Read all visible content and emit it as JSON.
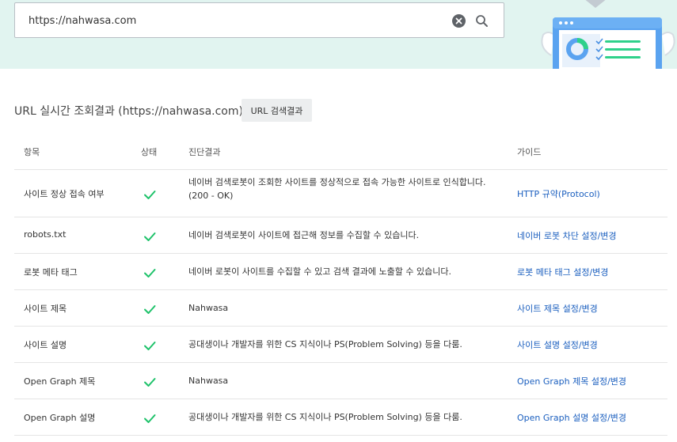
{
  "search": {
    "value": "https://nahwasa.com"
  },
  "header": {
    "title": "URL 실시간 조회결과 (https://nahwasa.com)",
    "result_button": "URL 검색결과"
  },
  "table": {
    "columns": [
      "항목",
      "상태",
      "진단결과",
      "가이드"
    ],
    "rows": [
      {
        "item": "사이트 정상 접속 여부",
        "status": "ok",
        "result": "네이버 검색로봇이 조회한 사이트를 정상적으로 접속 가능한 사이트로 인식합니다. (200 - OK)",
        "guide": "HTTP 규약(Protocol)"
      },
      {
        "item": "robots.txt",
        "status": "ok",
        "result": "네이버 검색로봇이 사이트에 접근해 정보를 수집할 수 있습니다.",
        "guide": "네이버 로봇 차단 설정/변경"
      },
      {
        "item": "로봇 메타 태그",
        "status": "ok",
        "result": "네이버 로봇이 사이트를 수집할 수 있고 검색 결과에 노출할 수 있습니다.",
        "guide": "로봇 메타 태그 설정/변경"
      },
      {
        "item": "사이트 제목",
        "status": "ok",
        "result": "Nahwasa",
        "guide": "사이트 제목 설정/변경"
      },
      {
        "item": "사이트 설명",
        "status": "ok",
        "result": "공대생이나 개발자를 위한 CS 지식이나 PS(Problem Solving) 등을 다룸.",
        "guide": "사이트 설명 설정/변경"
      },
      {
        "item": "Open Graph 제목",
        "status": "ok",
        "result": "Nahwasa",
        "guide": "Open Graph 제목 설정/변경"
      },
      {
        "item": "Open Graph 설명",
        "status": "ok",
        "result": "공대생이나 개발자를 위한 CS 지식이나 PS(Problem Solving) 등을 다룸.",
        "guide": "Open Graph 설명 설정/변경"
      }
    ]
  },
  "colors": {
    "hero_bg": "#e1f4f0",
    "check": "#1ec26a",
    "link": "#1b5fbf"
  },
  "icons": {
    "clear": "close-circle-icon",
    "search": "search-icon",
    "status_ok": "check-icon"
  }
}
